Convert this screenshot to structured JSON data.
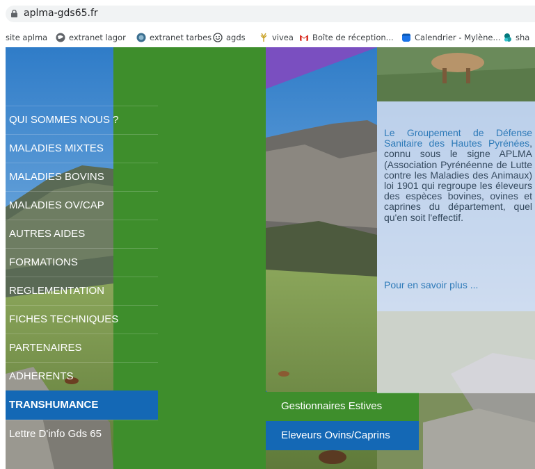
{
  "browser": {
    "url": "aplma-gds65.fr",
    "bookmarks": [
      {
        "label": "site aplma",
        "icon": "none"
      },
      {
        "label": "extranet lagor",
        "icon": "globe-icon"
      },
      {
        "label": "extranet tarbes",
        "icon": "globe-icon"
      },
      {
        "label": "agds",
        "icon": "smiley-icon"
      },
      {
        "label": "vivea",
        "icon": "vivea-icon"
      },
      {
        "label": "Boîte de réception...",
        "icon": "gmail-icon"
      },
      {
        "label": "Calendrier - Mylène...",
        "icon": "calendar-icon"
      },
      {
        "label": "sha",
        "icon": "sharepoint-icon"
      }
    ]
  },
  "menu": {
    "items": [
      {
        "label": "QUI SOMMES NOUS ?"
      },
      {
        "label": "MALADIES MIXTES"
      },
      {
        "label": "MALADIES BOVINS"
      },
      {
        "label": "MALADIES OV/CAP"
      },
      {
        "label": "AUTRES AIDES"
      },
      {
        "label": "FORMATIONS"
      },
      {
        "label": "REGLEMENTATION"
      },
      {
        "label": "FICHES TECHNIQUES"
      },
      {
        "label": "PARTENAIRES"
      },
      {
        "label": "ADHERENTS"
      },
      {
        "label": "TRANSHUMANCE",
        "active": true
      },
      {
        "label": "Lettre D'info Gds 65"
      }
    ],
    "submenu": [
      {
        "label": "Gestionnaires Estives"
      },
      {
        "label": "Eleveurs Ovins/Caprins"
      }
    ]
  },
  "content": {
    "intro_highlight": "Le Groupement de Défense Sanitaire des Hautes Pyrénées",
    "intro_rest": ", connu sous le signe APLMA (Association Pyrénéenne de Lutte contre les Maladies des Animaux) loi 1901 qui regroupe les éleveurs des espèces bovines, ovines et caprines du département, quel qu'en soit l'effectif.",
    "more_link": "Pour en savoir plus ..."
  },
  "colors": {
    "menu_green": "#3e8e2c",
    "active_blue": "#1468b5",
    "text_blue": "#2d7ab8",
    "purple": "#7a4fc0"
  }
}
